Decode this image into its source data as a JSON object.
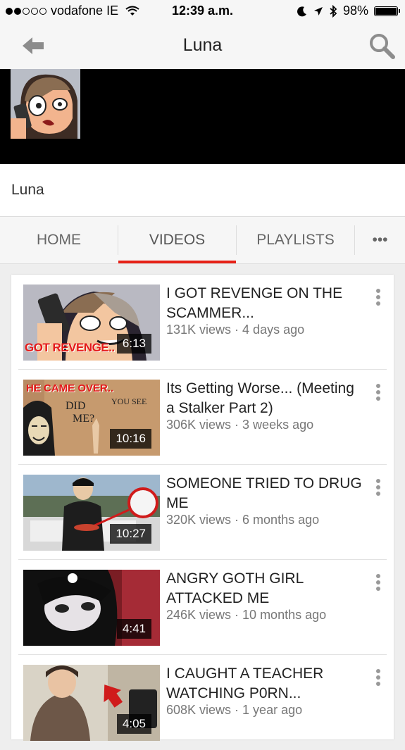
{
  "status_bar": {
    "carrier": "vodafone IE",
    "time": "12:39 a.m.",
    "battery": "98%",
    "battery_level": 0.98
  },
  "nav": {
    "title": "Luna"
  },
  "channel": {
    "name": "Luna"
  },
  "tabs": [
    {
      "label": "HOME"
    },
    {
      "label": "VIDEOS",
      "active": true
    },
    {
      "label": "PLAYLISTS"
    },
    {
      "label": "•••"
    }
  ],
  "colors": {
    "accent": "#e62117"
  },
  "videos": [
    {
      "title": "I GOT REVENGE ON THE SCAMMER...",
      "meta": "131K views · 4 days ago",
      "duration": "6:13",
      "thumb_text": "GOT REVENGE.."
    },
    {
      "title": "Its Getting Worse... (Meeting a Stalker Part 2)",
      "meta": "306K views · 3 weeks ago",
      "duration": "10:16",
      "thumb_text": "HE CAME OVER.."
    },
    {
      "title": "SOMEONE TRIED TO DRUG ME",
      "meta": "320K views · 6 months ago",
      "duration": "10:27",
      "thumb_text": ""
    },
    {
      "title": "ANGRY GOTH GIRL ATTACKED ME",
      "meta": "246K views · 10 months ago",
      "duration": "4:41",
      "thumb_text": ""
    },
    {
      "title": "I CAUGHT A TEACHER WATCHING P0RN...",
      "meta": "608K views · 1 year ago",
      "duration": "4:05",
      "thumb_text": ""
    }
  ]
}
